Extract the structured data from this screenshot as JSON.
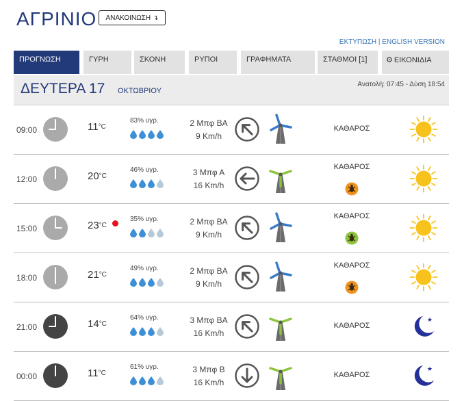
{
  "header": {
    "city": "ΑΓΡΙΝΙΟ",
    "announce_label": "ΑΝΑΚΟΙΝΩΣΗ",
    "print_link": "ΕΚΤΥΠΩΣΗ",
    "english_link": "ENGLISH VERSION",
    "link_separator": "|"
  },
  "tabs": [
    {
      "label": "ΠΡΟΓΝΩΣΗ",
      "active": true
    },
    {
      "label": "ΓΥΡΗ"
    },
    {
      "label": "ΣΚΟΝΗ"
    },
    {
      "label": "ΡΥΠΟΙ"
    },
    {
      "label": "ΓΡΑΦΗΜΑΤΑ"
    },
    {
      "label": "ΣΤΑΘΜΟΙ [1]"
    },
    {
      "label": "ΕΙΚΟΝΙΔΙΑ",
      "icon": "gear-icon"
    }
  ],
  "day": {
    "name": "ΔΕΥΤΕΡΑ 17",
    "month": "ΟΚΤΩΒΡΙΟΥ",
    "sun_times": "Ανατολή: 07:45 - Δύση 18:54"
  },
  "temp_unit": "°C",
  "colors": {
    "brand": "#233a7a",
    "drop_full": "#3d8fd6",
    "drop_empty": "#b7c9d9",
    "clock_day": "#aaaaaa",
    "clock_night": "#444444",
    "sun": "#f7c21b",
    "moon": "#26309a",
    "turbine_blue": "#3a7bc8",
    "turbine_green": "#8cc43c",
    "pollen_orange": "#f0921e",
    "pollen_green": "#8cc43c",
    "max_dot": "#e8101a"
  },
  "rows": [
    {
      "time": "09:00",
      "clock": "day",
      "temp": "11",
      "max": false,
      "humidity": "83% υγρ.",
      "drops_full": 4,
      "wind_force": "2 Μπφ ΒΑ",
      "wind_speed": "9 Km/h",
      "wind_dir": "arrow-southwest-icon",
      "turbine": "blue",
      "sky": "ΚΑΘΑΡΟΣ",
      "pollen": null,
      "weather_icon": "sun-icon"
    },
    {
      "time": "12:00",
      "clock": "day",
      "temp": "20",
      "max": false,
      "humidity": "46% υγρ.",
      "drops_full": 3,
      "wind_force": "3 Μπφ Α",
      "wind_speed": "16 Km/h",
      "wind_dir": "arrow-west-icon",
      "turbine": "green",
      "sky": "ΚΑΘΑΡΟΣ",
      "pollen": "orange",
      "weather_icon": "sun-icon"
    },
    {
      "time": "15:00",
      "clock": "day",
      "temp": "23",
      "max": true,
      "humidity": "35% υγρ.",
      "drops_full": 2,
      "wind_force": "2 Μπφ ΒΑ",
      "wind_speed": "9 Km/h",
      "wind_dir": "arrow-southwest-icon",
      "turbine": "blue",
      "sky": "ΚΑΘΑΡΟΣ",
      "pollen": "green",
      "weather_icon": "sun-icon"
    },
    {
      "time": "18:00",
      "clock": "day",
      "temp": "21",
      "max": false,
      "humidity": "49% υγρ.",
      "drops_full": 3,
      "wind_force": "2 Μπφ ΒΑ",
      "wind_speed": "9 Km/h",
      "wind_dir": "arrow-southwest-icon",
      "turbine": "blue",
      "sky": "ΚΑΘΑΡΟΣ",
      "pollen": "orange",
      "weather_icon": "sun-icon"
    },
    {
      "time": "21:00",
      "clock": "night",
      "temp": "14",
      "max": false,
      "humidity": "64% υγρ.",
      "drops_full": 3,
      "wind_force": "3 Μπφ ΒΑ",
      "wind_speed": "16 Km/h",
      "wind_dir": "arrow-southwest-icon",
      "turbine": "green",
      "sky": "ΚΑΘΑΡΟΣ",
      "pollen": null,
      "weather_icon": "moon-icon"
    },
    {
      "time": "00:00",
      "clock": "night",
      "temp": "11",
      "max": false,
      "humidity": "61% υγρ.",
      "drops_full": 3,
      "wind_force": "3 Μπφ Β",
      "wind_speed": "16 Km/h",
      "wind_dir": "arrow-south-icon",
      "turbine": "green",
      "sky": "ΚΑΘΑΡΟΣ",
      "pollen": null,
      "weather_icon": "moon-icon"
    }
  ]
}
